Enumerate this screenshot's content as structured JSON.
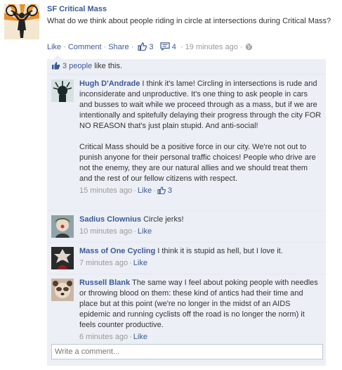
{
  "post": {
    "page_name": "SF Critical Mass",
    "text": "What do we think about people riding in circle at intersections during Critical Mass?",
    "actions": {
      "like": "Like",
      "comment": "Comment",
      "share": "Share",
      "like_count": "3",
      "comment_count": "4",
      "time": "19 minutes ago"
    }
  },
  "likes_summary": {
    "count_link": "3 people",
    "suffix": " like this."
  },
  "comments": [
    {
      "author": "Hugh D'Andrade",
      "paragraphs": [
        " I think it's lame! Circling in intersections is rude and inconsiderate and unproductive. It's one thing to ask people in cars and busses to wait while we proceed through as a mass, but if we are intentionally and spitefully delaying their progress through the city FOR NO REASON that's just plain stupid. And anti-social!",
        "Critical Mass should be a positive force in our city. We're not out to punish anyone for their personal traffic choices! People who drive are not the enemy, they are our natural allies and we should treat them and the rest of our fellow citizens with respect."
      ],
      "time": "15 minutes ago",
      "like": "Like",
      "like_count": "3"
    },
    {
      "author": "Sadius Clownius",
      "text": " Circle jerks!",
      "time": "10 minutes ago",
      "like": "Like"
    },
    {
      "author": "Mass of One Cycling",
      "text": " I think it is stupid as hell, but I love it.",
      "time": "7 minutes ago",
      "like": "Like"
    },
    {
      "author": "Russell Blank",
      "text": " The same way I feel about poking people with needles or throwing blood on them: these kind of antics had their time and place but at this point (we're no longer in the midst of an AIDS epidemic and running cyclists off the road is no longer the norm) it feels counter productive.",
      "time": "6 minutes ago",
      "like": "Like"
    }
  ],
  "write_comment": {
    "placeholder": "Write a comment..."
  },
  "colors": {
    "link": "#3b5998",
    "meta": "#999999",
    "feedback_bg": "#eceff5",
    "input_border": "#bdc7d8"
  },
  "icons": {
    "page_avatar": "bicycle-logo-avatar",
    "like": "thumbs-up-icon",
    "comment": "speech-bubble-icon",
    "privacy": "globe-icon"
  }
}
